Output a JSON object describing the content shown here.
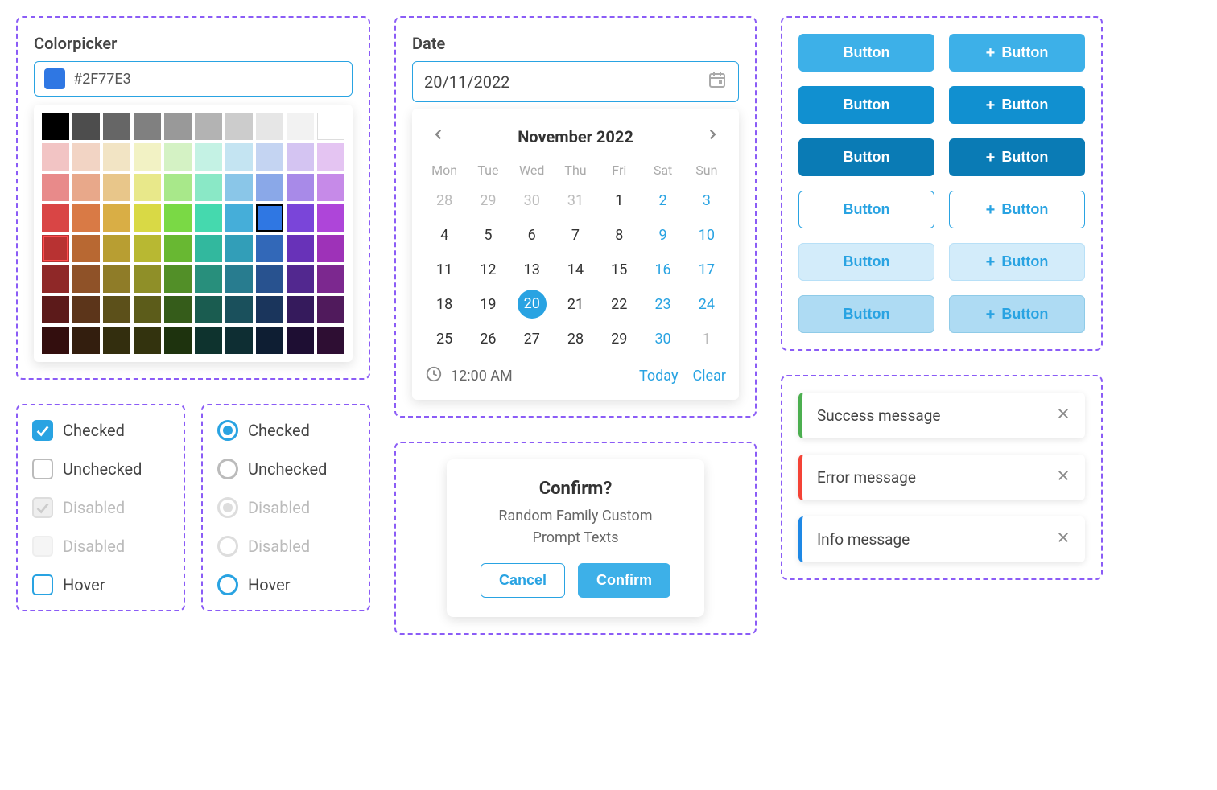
{
  "colorpicker": {
    "label": "Colorpicker",
    "value": "#2F77E3",
    "swatch_color": "#2F77E3",
    "selected_blue": "#2F77E3",
    "palette": [
      [
        "#000000",
        "#4d4d4d",
        "#666666",
        "#808080",
        "#999999",
        "#b3b3b3",
        "#cccccc",
        "#e6e6e6",
        "#f2f2f2",
        "#ffffff"
      ],
      [
        "#f2c4c4",
        "#f2d4c4",
        "#f2e4c4",
        "#f2f2c4",
        "#d4f2c4",
        "#c4f2e4",
        "#c4e4f2",
        "#c4d4f2",
        "#d4c4f2",
        "#e4c4f2"
      ],
      [
        "#e88a8a",
        "#e8a88a",
        "#e8c68a",
        "#e8e88a",
        "#a8e88a",
        "#8ae8c6",
        "#8ac6e8",
        "#8aa8e8",
        "#a88ae8",
        "#c68ae8"
      ],
      [
        "#d94545",
        "#d97a45",
        "#d9ae45",
        "#d9d945",
        "#7ad945",
        "#45d9ae",
        "#45aed9",
        "#2F77E3",
        "#7a45d9",
        "#ae45d9"
      ],
      [
        "#b83232",
        "#b86832",
        "#b89e32",
        "#b8b832",
        "#68b832",
        "#32b89e",
        "#329eb8",
        "#3268b8",
        "#6832b8",
        "#9e32b8"
      ],
      [
        "#8f2828",
        "#8f5228",
        "#8f7c28",
        "#8f8f28",
        "#528f28",
        "#288f7c",
        "#287c8f",
        "#28528f",
        "#52288f",
        "#7c288f"
      ],
      [
        "#5c1a1a",
        "#5c351a",
        "#5c501a",
        "#5c5c1a",
        "#355c1a",
        "#1a5c50",
        "#1a505c",
        "#1a355c",
        "#351a5c",
        "#501a5c"
      ],
      [
        "#330e0e",
        "#331e0e",
        "#332e0e",
        "#33330e",
        "#1e330e",
        "#0e332e",
        "#0e2e33",
        "#0e1e33",
        "#1e0e33",
        "#2e0e33"
      ]
    ]
  },
  "checkboxes": {
    "checked": "Checked",
    "unchecked": "Unchecked",
    "disabled": "Disabled",
    "hover": "Hover"
  },
  "radios": {
    "checked": "Checked",
    "unchecked": "Unchecked",
    "disabled": "Disabled",
    "hover": "Hover"
  },
  "date": {
    "label": "Date",
    "value": "20/11/2022",
    "month_title": "November 2022",
    "dow": [
      "Mon",
      "Tue",
      "Wed",
      "Thu",
      "Fri",
      "Sat",
      "Sun"
    ],
    "days": [
      {
        "n": "28",
        "muted": true
      },
      {
        "n": "29",
        "muted": true
      },
      {
        "n": "30",
        "muted": true
      },
      {
        "n": "31",
        "muted": true
      },
      {
        "n": "1"
      },
      {
        "n": "2",
        "weekend": true
      },
      {
        "n": "3",
        "weekend": true
      },
      {
        "n": "4"
      },
      {
        "n": "5"
      },
      {
        "n": "6"
      },
      {
        "n": "7"
      },
      {
        "n": "8"
      },
      {
        "n": "9",
        "weekend": true
      },
      {
        "n": "10",
        "weekend": true
      },
      {
        "n": "11"
      },
      {
        "n": "12"
      },
      {
        "n": "13"
      },
      {
        "n": "14"
      },
      {
        "n": "15"
      },
      {
        "n": "16",
        "weekend": true
      },
      {
        "n": "17",
        "weekend": true
      },
      {
        "n": "18"
      },
      {
        "n": "19"
      },
      {
        "n": "20",
        "selected": true
      },
      {
        "n": "21"
      },
      {
        "n": "22"
      },
      {
        "n": "23",
        "weekend": true
      },
      {
        "n": "24",
        "weekend": true
      },
      {
        "n": "25"
      },
      {
        "n": "26"
      },
      {
        "n": "27"
      },
      {
        "n": "28"
      },
      {
        "n": "29"
      },
      {
        "n": "30",
        "weekend": true
      },
      {
        "n": "1",
        "muted": true
      }
    ],
    "time": "12:00 AM",
    "today": "Today",
    "clear": "Clear"
  },
  "confirm": {
    "title": "Confirm?",
    "text1": "Random Family Custom",
    "text2": "Prompt Texts",
    "cancel": "Cancel",
    "confirm": "Confirm"
  },
  "buttons": {
    "label": "Button"
  },
  "alerts": {
    "success": "Success message",
    "error": "Error message",
    "info": "Info message"
  }
}
